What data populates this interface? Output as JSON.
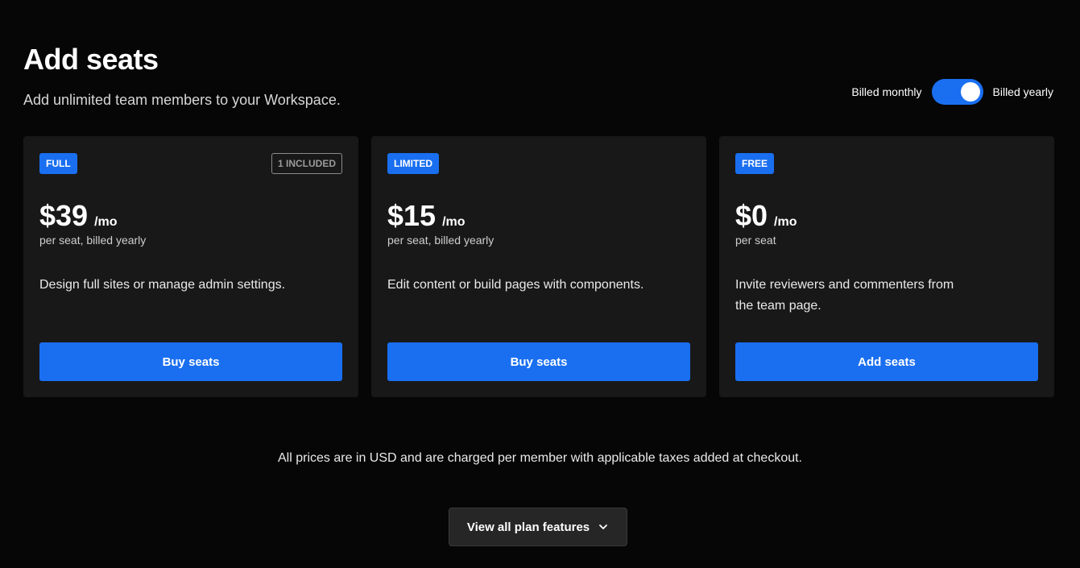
{
  "header": {
    "title": "Add seats",
    "subtitle": "Add unlimited team members to your Workspace."
  },
  "billing": {
    "monthly_label": "Billed monthly",
    "yearly_label": "Billed yearly",
    "selected": "yearly"
  },
  "plans": [
    {
      "badge": "FULL",
      "included": "1 INCLUDED",
      "price": "$39",
      "per": "/mo",
      "note": "per seat, billed yearly",
      "description": "Design full sites or manage admin settings.",
      "cta": "Buy seats"
    },
    {
      "badge": "LIMITED",
      "price": "$15",
      "per": "/mo",
      "note": "per seat, billed yearly",
      "description": "Edit content or build pages with components.",
      "cta": "Buy seats"
    },
    {
      "badge": "FREE",
      "price": "$0",
      "per": "/mo",
      "note": "per seat",
      "description": "Invite reviewers and commenters from the team page.",
      "cta": "Add seats"
    }
  ],
  "footnote": "All prices are in USD and are charged per member with applicable taxes added at checkout.",
  "features_button": {
    "label": "View all plan features",
    "icon": "chevron-down-icon"
  },
  "colors": {
    "accent": "#1a6ff0",
    "background": "#060606",
    "card": "#181818"
  }
}
